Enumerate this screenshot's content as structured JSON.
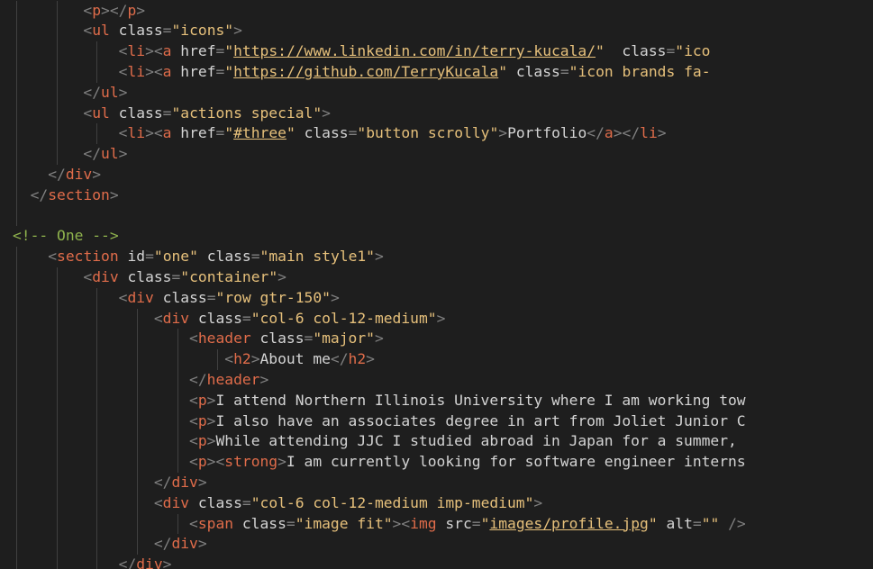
{
  "editor": {
    "colors": {
      "background": "#1e1e1e",
      "tag": "#e06c4a",
      "punctuation": "#808080",
      "attribute": "#d4d4d4",
      "string": "#e6c07b",
      "text": "#d4d4d4",
      "comment": "#8fb34d",
      "indent_guide": "#404040"
    },
    "lines": [
      {
        "indent": 8,
        "tokens": [
          [
            "punct",
            "<"
          ],
          [
            "tag",
            "p"
          ],
          [
            "punct",
            "></"
          ],
          [
            "tag",
            "p"
          ],
          [
            "punct",
            ">"
          ]
        ]
      },
      {
        "indent": 8,
        "tokens": [
          [
            "punct",
            "<"
          ],
          [
            "tag",
            "ul"
          ],
          [
            "attr",
            " class"
          ],
          [
            "punct",
            "="
          ],
          [
            "string",
            "\"icons\""
          ],
          [
            "punct",
            ">"
          ]
        ]
      },
      {
        "indent": 12,
        "tokens": [
          [
            "punct",
            "<"
          ],
          [
            "tag",
            "li"
          ],
          [
            "punct",
            "><"
          ],
          [
            "tag",
            "a"
          ],
          [
            "attr",
            " href"
          ],
          [
            "punct",
            "="
          ],
          [
            "string",
            "\""
          ],
          [
            "link",
            "https://www.linkedin.com/in/terry-kucala/"
          ],
          [
            "string",
            "\""
          ],
          [
            "attr",
            "  class"
          ],
          [
            "punct",
            "="
          ],
          [
            "string",
            "\"ico"
          ]
        ]
      },
      {
        "indent": 12,
        "tokens": [
          [
            "punct",
            "<"
          ],
          [
            "tag",
            "li"
          ],
          [
            "punct",
            "><"
          ],
          [
            "tag",
            "a"
          ],
          [
            "attr",
            " href"
          ],
          [
            "punct",
            "="
          ],
          [
            "string",
            "\""
          ],
          [
            "link",
            "https://github.com/TerryKucala"
          ],
          [
            "string",
            "\""
          ],
          [
            "attr",
            " class"
          ],
          [
            "punct",
            "="
          ],
          [
            "string",
            "\"icon brands fa-"
          ]
        ]
      },
      {
        "indent": 8,
        "tokens": [
          [
            "punct",
            "</"
          ],
          [
            "tag",
            "ul"
          ],
          [
            "punct",
            ">"
          ]
        ]
      },
      {
        "indent": 8,
        "tokens": [
          [
            "punct",
            "<"
          ],
          [
            "tag",
            "ul"
          ],
          [
            "attr",
            " class"
          ],
          [
            "punct",
            "="
          ],
          [
            "string",
            "\"actions special\""
          ],
          [
            "punct",
            ">"
          ]
        ]
      },
      {
        "indent": 12,
        "tokens": [
          [
            "punct",
            "<"
          ],
          [
            "tag",
            "li"
          ],
          [
            "punct",
            "><"
          ],
          [
            "tag",
            "a"
          ],
          [
            "attr",
            " href"
          ],
          [
            "punct",
            "="
          ],
          [
            "string",
            "\""
          ],
          [
            "link",
            "#three"
          ],
          [
            "string",
            "\""
          ],
          [
            "attr",
            " class"
          ],
          [
            "punct",
            "="
          ],
          [
            "string",
            "\"button scrolly\""
          ],
          [
            "punct",
            ">"
          ],
          [
            "text",
            "Portfolio"
          ],
          [
            "punct",
            "</"
          ],
          [
            "tag",
            "a"
          ],
          [
            "punct",
            "></"
          ],
          [
            "tag",
            "li"
          ],
          [
            "punct",
            ">"
          ]
        ]
      },
      {
        "indent": 8,
        "tokens": [
          [
            "punct",
            "</"
          ],
          [
            "tag",
            "ul"
          ],
          [
            "punct",
            ">"
          ]
        ]
      },
      {
        "indent": 4,
        "tokens": [
          [
            "punct",
            "</"
          ],
          [
            "tag",
            "div"
          ],
          [
            "punct",
            ">"
          ]
        ]
      },
      {
        "indent": 2,
        "tokens": [
          [
            "punct",
            "</"
          ],
          [
            "tag",
            "section"
          ],
          [
            "punct",
            ">"
          ]
        ]
      },
      {
        "indent": 0,
        "tokens": []
      },
      {
        "indent": 0,
        "tokens": [
          [
            "comment",
            "<!-- One -->"
          ]
        ]
      },
      {
        "indent": 4,
        "tokens": [
          [
            "punct",
            "<"
          ],
          [
            "tag",
            "section"
          ],
          [
            "attr",
            " id"
          ],
          [
            "punct",
            "="
          ],
          [
            "string",
            "\"one\""
          ],
          [
            "attr",
            " class"
          ],
          [
            "punct",
            "="
          ],
          [
            "string",
            "\"main style1\""
          ],
          [
            "punct",
            ">"
          ]
        ]
      },
      {
        "indent": 8,
        "tokens": [
          [
            "punct",
            "<"
          ],
          [
            "tag",
            "div"
          ],
          [
            "attr",
            " class"
          ],
          [
            "punct",
            "="
          ],
          [
            "string",
            "\"container\""
          ],
          [
            "punct",
            ">"
          ]
        ]
      },
      {
        "indent": 12,
        "tokens": [
          [
            "punct",
            "<"
          ],
          [
            "tag",
            "div"
          ],
          [
            "attr",
            " class"
          ],
          [
            "punct",
            "="
          ],
          [
            "string",
            "\"row gtr-150\""
          ],
          [
            "punct",
            ">"
          ]
        ]
      },
      {
        "indent": 16,
        "tokens": [
          [
            "punct",
            "<"
          ],
          [
            "tag",
            "div"
          ],
          [
            "attr",
            " class"
          ],
          [
            "punct",
            "="
          ],
          [
            "string",
            "\"col-6 col-12-medium\""
          ],
          [
            "punct",
            ">"
          ]
        ]
      },
      {
        "indent": 20,
        "tokens": [
          [
            "punct",
            "<"
          ],
          [
            "tag",
            "header"
          ],
          [
            "attr",
            " class"
          ],
          [
            "punct",
            "="
          ],
          [
            "string",
            "\"major\""
          ],
          [
            "punct",
            ">"
          ]
        ]
      },
      {
        "indent": 24,
        "tokens": [
          [
            "punct",
            "<"
          ],
          [
            "tag",
            "h2"
          ],
          [
            "punct",
            ">"
          ],
          [
            "text",
            "About me"
          ],
          [
            "punct",
            "</"
          ],
          [
            "tag",
            "h2"
          ],
          [
            "punct",
            ">"
          ]
        ]
      },
      {
        "indent": 20,
        "tokens": [
          [
            "punct",
            "</"
          ],
          [
            "tag",
            "header"
          ],
          [
            "punct",
            ">"
          ]
        ]
      },
      {
        "indent": 20,
        "tokens": [
          [
            "punct",
            "<"
          ],
          [
            "tag",
            "p"
          ],
          [
            "punct",
            ">"
          ],
          [
            "text",
            "I attend Northern Illinois University where I am working tow"
          ]
        ]
      },
      {
        "indent": 20,
        "tokens": [
          [
            "punct",
            "<"
          ],
          [
            "tag",
            "p"
          ],
          [
            "punct",
            ">"
          ],
          [
            "text",
            "I also have an associates degree in art from Joliet Junior C"
          ]
        ]
      },
      {
        "indent": 20,
        "tokens": [
          [
            "punct",
            "<"
          ],
          [
            "tag",
            "p"
          ],
          [
            "punct",
            ">"
          ],
          [
            "text",
            "While attending JJC I studied abroad in Japan for a summer,"
          ]
        ]
      },
      {
        "indent": 20,
        "tokens": [
          [
            "punct",
            "<"
          ],
          [
            "tag",
            "p"
          ],
          [
            "punct",
            "><"
          ],
          [
            "tag",
            "strong"
          ],
          [
            "punct",
            ">"
          ],
          [
            "text",
            "I am currently looking for software engineer interns"
          ]
        ]
      },
      {
        "indent": 16,
        "tokens": [
          [
            "punct",
            "</"
          ],
          [
            "tag",
            "div"
          ],
          [
            "punct",
            ">"
          ]
        ]
      },
      {
        "indent": 16,
        "tokens": [
          [
            "punct",
            "<"
          ],
          [
            "tag",
            "div"
          ],
          [
            "attr",
            " class"
          ],
          [
            "punct",
            "="
          ],
          [
            "string",
            "\"col-6 col-12-medium imp-medium\""
          ],
          [
            "punct",
            ">"
          ]
        ]
      },
      {
        "indent": 20,
        "tokens": [
          [
            "punct",
            "<"
          ],
          [
            "tag",
            "span"
          ],
          [
            "attr",
            " class"
          ],
          [
            "punct",
            "="
          ],
          [
            "string",
            "\"image fit\""
          ],
          [
            "punct",
            "><"
          ],
          [
            "tag",
            "img"
          ],
          [
            "attr",
            " src"
          ],
          [
            "punct",
            "="
          ],
          [
            "string",
            "\""
          ],
          [
            "link",
            "images/profile.jpg"
          ],
          [
            "string",
            "\""
          ],
          [
            "attr",
            " alt"
          ],
          [
            "punct",
            "="
          ],
          [
            "string",
            "\"\""
          ],
          [
            "punct",
            " />"
          ]
        ]
      },
      {
        "indent": 16,
        "tokens": [
          [
            "punct",
            "</"
          ],
          [
            "tag",
            "div"
          ],
          [
            "punct",
            ">"
          ]
        ]
      },
      {
        "indent": 12,
        "tokens": [
          [
            "punct",
            "</"
          ],
          [
            "tag",
            "div"
          ],
          [
            "punct",
            ">"
          ]
        ]
      }
    ]
  }
}
